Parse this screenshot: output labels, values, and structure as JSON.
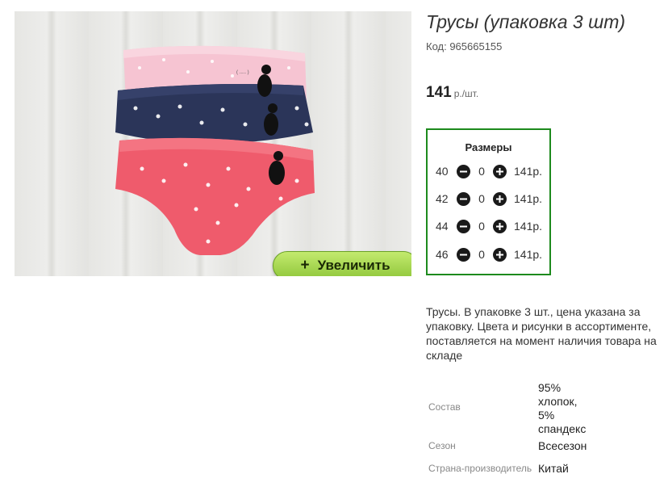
{
  "product": {
    "title": "Трусы (упаковка 3 шт)",
    "code_label": "Код: 965665155",
    "price": "141",
    "price_unit": "р./шт.",
    "zoom_label": "Увеличить",
    "zoom_plus": "+",
    "image_lettering": "( ..... )"
  },
  "sizes": {
    "title": "Размеры",
    "rows": [
      {
        "size": "40",
        "qty": "0",
        "price": "141р."
      },
      {
        "size": "42",
        "qty": "0",
        "price": "141р."
      },
      {
        "size": "44",
        "qty": "0",
        "price": "141р."
      },
      {
        "size": "46",
        "qty": "0",
        "price": "141р."
      }
    ]
  },
  "description": "Трусы. В упаковке 3 шт., цена указана за упаковку. Цвета и рисунки в ассортименте, поставляется на момент наличия товара на складе",
  "specs": [
    {
      "label": "Состав",
      "value": "95% хлопок, 5% спандекс"
    },
    {
      "label": "Сезон",
      "value": "Всесезон"
    },
    {
      "label": "Страна-производитель",
      "value": "Китай"
    }
  ],
  "colors": {
    "pink": "#f6c4d2",
    "navy": "#2b3559",
    "coral": "#ef5b6c",
    "frame_green": "#1d8a1d",
    "button_green": "#a3d24e"
  }
}
